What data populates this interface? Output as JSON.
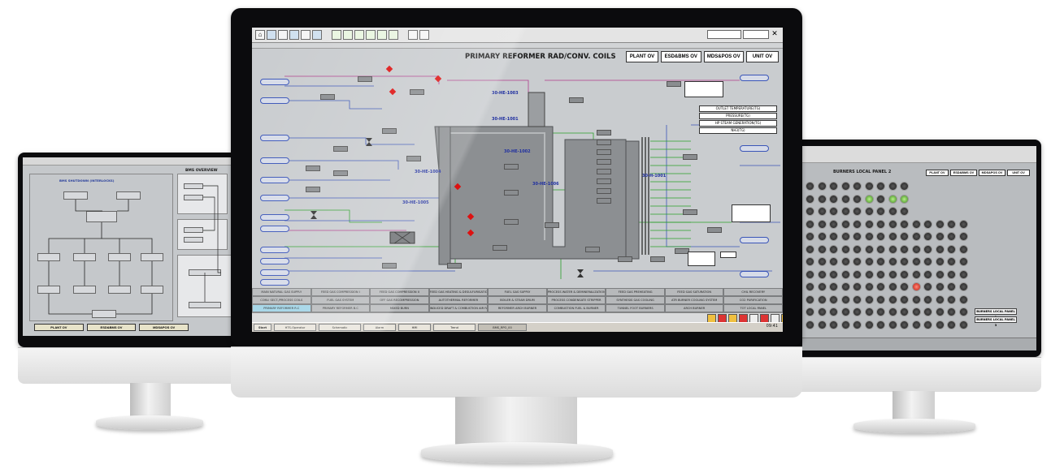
{
  "center": {
    "title": "PRIMARY REFORMER RAD/CONV. COILS",
    "ov_buttons": [
      "PLANT OV",
      "ESD&BMS OV",
      "MDS&POS OV",
      "UNIT OV"
    ],
    "coil_labels": [
      "30-HE-1003",
      "30-HE-1001",
      "30-HE-1002",
      "30-HE-1004",
      "30-HE-1005",
      "30-HE-1006",
      "30-H-1001"
    ],
    "info_boxes": [
      "OUTLET TEMPERATURE(TG)",
      "PRESSURE(TG)",
      "HP STEAM GENERATION(TG)",
      "NH3(TG)"
    ],
    "nav_rows": [
      [
        "MAIN NATURAL GAS SUPPLY",
        "FEED GAS COMPRESSION I",
        "FEED GAS COMPRESSION II",
        "FEED GAS HEATING & DESULFURISATION",
        "FUEL GAS SUPPLY",
        "PROCESS WATER & DEMINERALIZATION",
        "FEED GAS PREHEATING",
        "FEED GAS SATURATION",
        "CHIL RECOVERY"
      ],
      [
        "CONV. SECT./PROCESS COILS",
        "FUEL GAS SYSTEM",
        "OFF GAS RECOMPRESSION",
        "AUTOTHERMAL REFORMER",
        "BOILER & STEAM DRUM",
        "PROCESS CONDENSATE STRIPPER",
        "SYNTHESIS GAS COOLING",
        "ATR BURNER COOLING SYSTEM",
        "CO2 PURIFICATION"
      ],
      [
        "PRIMARY REFORMER R.C",
        "PRIMARY REFORMER B.C",
        "MIXED BURN",
        "INDUCED DRAFT & COMBUSTION AIR FAN",
        "REFORMER ARCH BURNER",
        "COMBUSTION FUEL & BURNER",
        "TUNNEL FOOT BURNERS",
        "ARCH BURNER",
        "TOT LOCAL PANEL"
      ]
    ],
    "taskbar_items": [
      "Start",
      "HTS-Operator",
      "Schematic",
      "Alarm",
      "HMI",
      "Trend",
      "BMS_RPO_00"
    ],
    "clock": "09:41"
  },
  "left": {
    "title": "BMS OVERVIEW",
    "subtitle": "BMS SHUTDOWN (INTERLOCKS)",
    "ov_buttons": [
      "PLANT OV",
      "ESD&BMS OV",
      "MDS&POS OV"
    ]
  },
  "right": {
    "title": "BURNERS LOCAL PANEL 2",
    "ov_buttons": [
      "PLANT OV",
      "ESD&BMS OV",
      "MDS&POS OV",
      "UNIT OV"
    ],
    "panel_buttons": [
      "BURNERS LOCAL PANEL 1",
      "BURNERS LOCAL PANEL 3"
    ]
  },
  "colors": {
    "screen_bg": "#c9cccf",
    "coil_blue": "#1f2fa0",
    "alarm_red": "#d11111",
    "ok_green": "#3c8a1c",
    "nav_active": "#9fd3e6"
  }
}
